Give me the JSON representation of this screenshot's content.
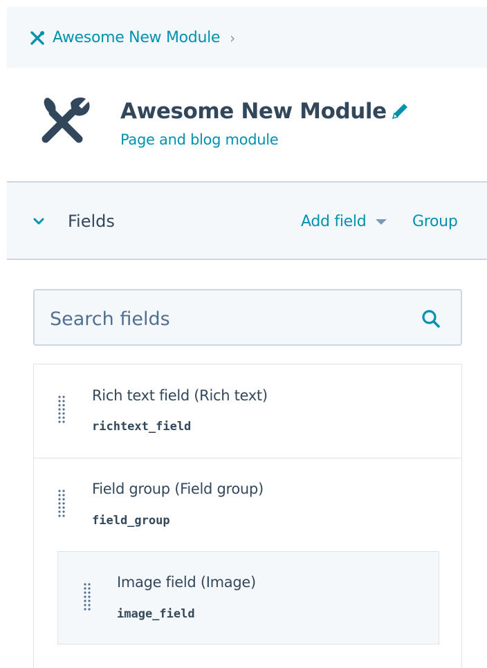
{
  "breadcrumb": {
    "icon": "tools-icon",
    "label": "Awesome New Module",
    "chevron": "›"
  },
  "module": {
    "icon": "wrench-brush-icon",
    "title": "Awesome New Module",
    "subtitle": "Page and blog module",
    "edit_icon": "pencil-icon"
  },
  "fields_bar": {
    "collapse_icon": "chevron-down-icon",
    "label": "Fields",
    "add_field_label": "Add field",
    "group_label": "Group"
  },
  "search": {
    "placeholder": "Search fields",
    "value": "",
    "icon": "search-icon"
  },
  "fields": [
    {
      "name": "Rich text field (Rich text)",
      "key": "richtext_field"
    },
    {
      "name": "Field group (Field group)",
      "key": "field_group",
      "children": [
        {
          "name": "Image field (Image)",
          "key": "image_field"
        }
      ]
    }
  ],
  "colors": {
    "accent": "#0091ae",
    "text": "#33475b",
    "panel_bg": "#f5f8fa",
    "border": "#cbd6e2"
  }
}
